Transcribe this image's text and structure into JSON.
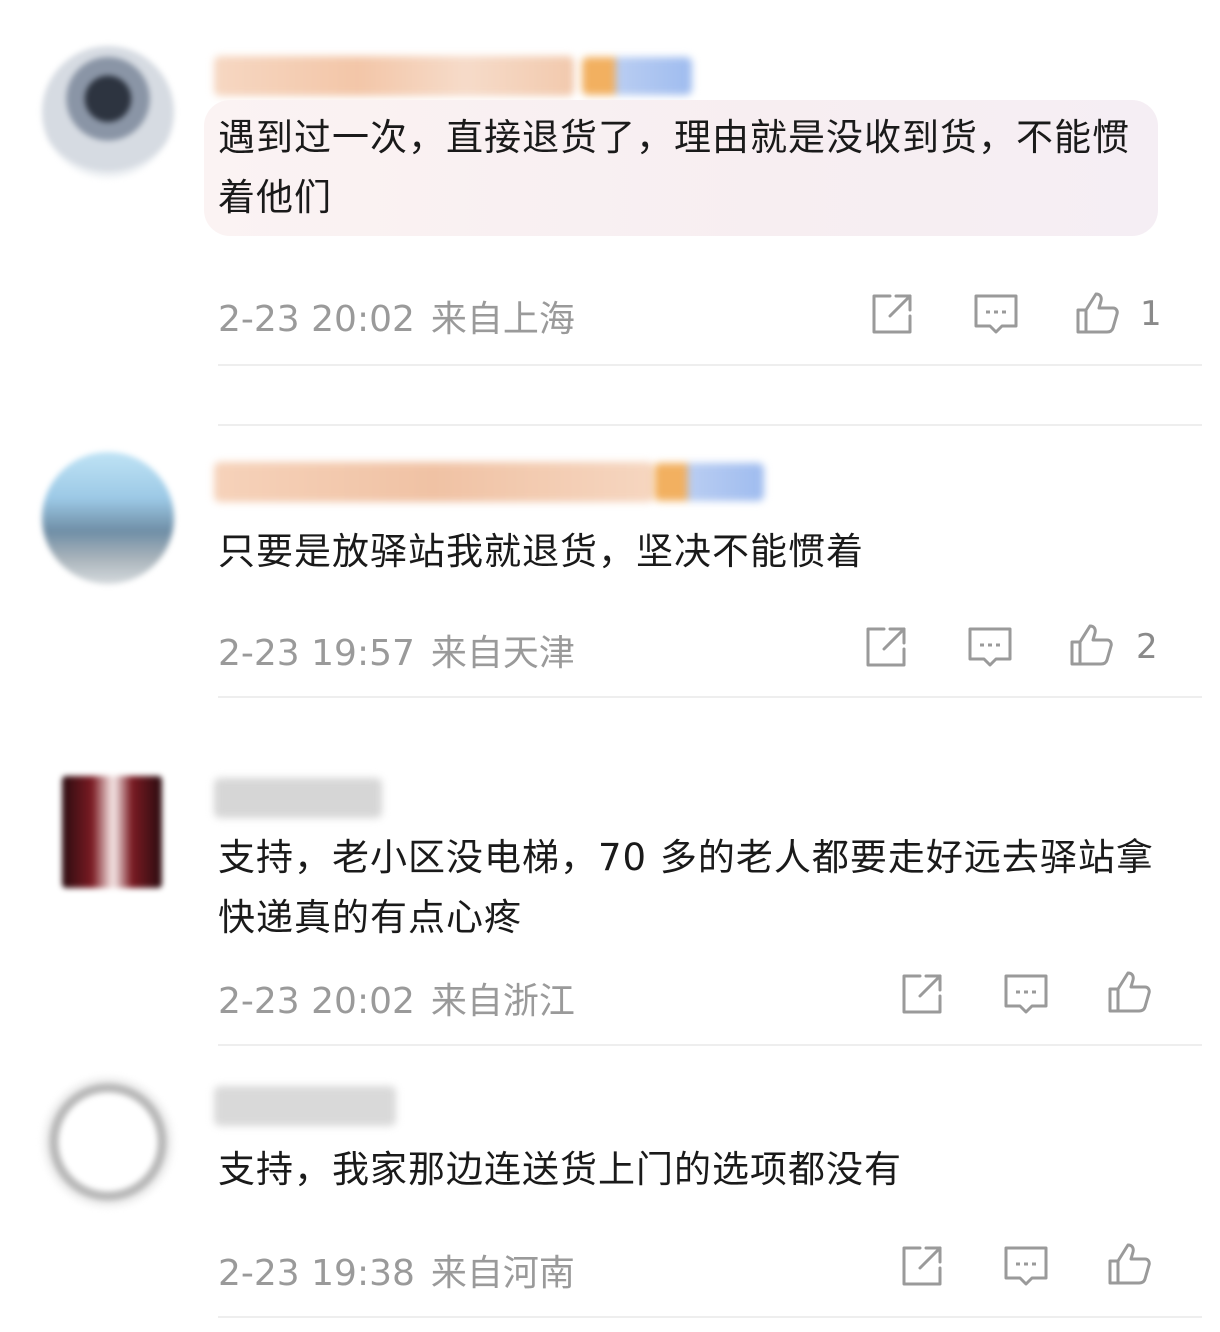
{
  "comments": [
    {
      "text": "遇到过一次，直接退货了，理由就是没收到货，不能惯着他们",
      "time": "2-23 20:02",
      "location": "来自上海",
      "likes": "1"
    },
    {
      "text": "只要是放驿站我就退货，坚决不能惯着",
      "time": "2-23 19:57",
      "location": "来自天津",
      "likes": "2"
    },
    {
      "text": "支持，老小区没电梯，70 多的老人都要走好远去驿站拿快递真的有点心疼",
      "time": "2-23 20:02",
      "location": "来自浙江",
      "likes": ""
    },
    {
      "text": "支持，我家那边连送货上门的选项都没有",
      "time": "2-23 19:38",
      "location": "来自河南",
      "likes": ""
    }
  ],
  "icons": {
    "share": "share-icon",
    "reply": "comment-icon",
    "like": "thumbs-up-icon"
  }
}
